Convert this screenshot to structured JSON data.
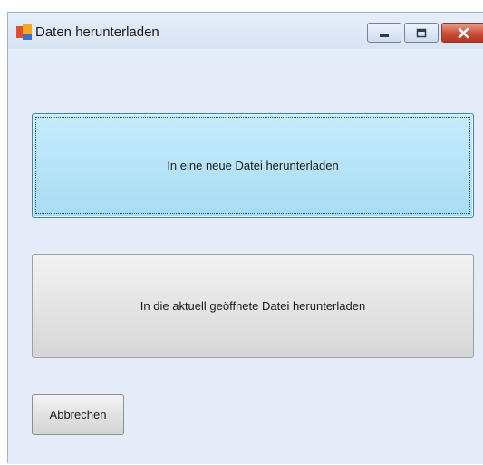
{
  "window": {
    "title": "Daten herunterladen",
    "app_icon": "app-logo-icon",
    "controls": {
      "minimize_icon": "minimize-icon",
      "maximize_icon": "maximize-icon",
      "close_icon": "close-icon"
    }
  },
  "actions": {
    "new_file_label": "In eine neue Datei herunterladen",
    "current_file_label": "In die aktuell geöffnete Datei herunterladen",
    "cancel_label": "Abbrechen"
  },
  "colors": {
    "primary_button": "#a9dcf5",
    "close_button": "#c94d37",
    "background": "#e3ecf8"
  }
}
